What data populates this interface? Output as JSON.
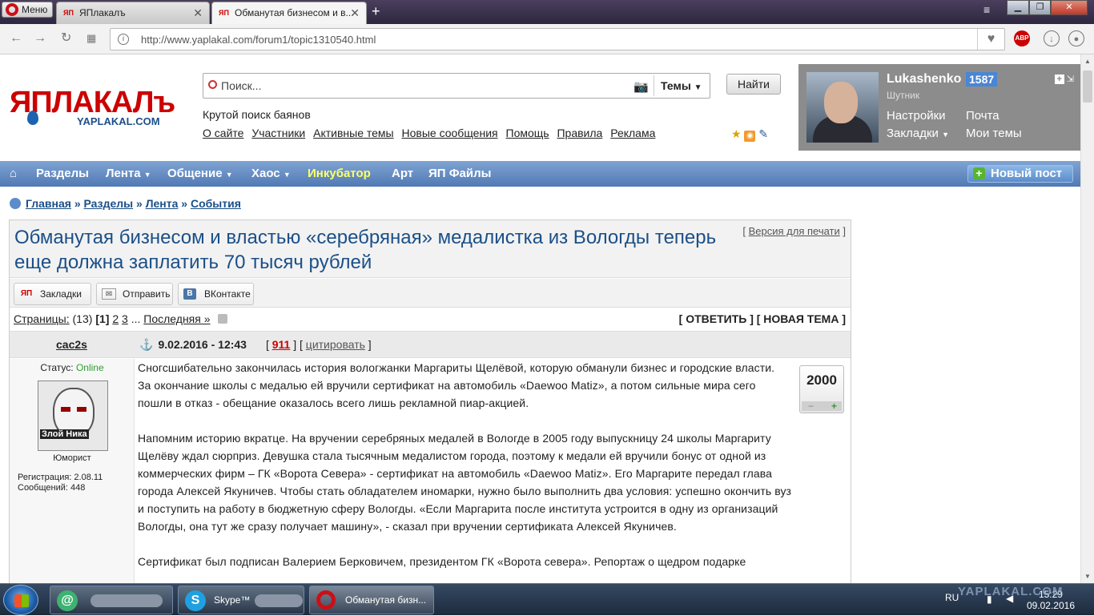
{
  "browser": {
    "menu_label": "Меню",
    "tabs": [
      {
        "favicon": "ЯП",
        "label": "ЯПлакалъ"
      },
      {
        "favicon": "ЯП",
        "label": "Обманутая бизнесом и в..."
      }
    ],
    "new_tab": "+",
    "url": "http://www.yaplakal.com/forum1/topic1310540.html"
  },
  "header": {
    "logo_main": "ЯПЛАКАЛъ",
    "logo_sub": "YAPLAKAL.COM",
    "search_placeholder": "Поиск...",
    "search_scope": "Темы",
    "search_button": "Найти",
    "tagline": "Крутой поиск баянов",
    "links": [
      "О сайте",
      "Участники",
      "Активные темы",
      "Новые сообщения",
      "Помощь",
      "Правила",
      "Реклама"
    ]
  },
  "user": {
    "name": "Lukashenko",
    "reputation": "1587",
    "rank": "Шутник",
    "links": {
      "settings": "Настройки",
      "mail": "Почта",
      "bookmarks": "Закладки",
      "my_topics": "Мои темы"
    }
  },
  "nav": {
    "home_icon": "home-icon",
    "items": [
      "Разделы",
      "Лента",
      "Общение",
      "Хаос",
      "Инкубатор",
      "Арт",
      "ЯП Файлы"
    ],
    "new_post": "Новый пост"
  },
  "breadcrumb": [
    "Главная",
    "Разделы",
    "Лента",
    "События"
  ],
  "topic": {
    "title": "Обманутая бизнесом и властью «серебряная» медалистка из Вологды теперь еще должна заплатить 70 тысяч рублей",
    "print_version": "Версия для печати",
    "share": {
      "bookmarks": "Закладки",
      "send": "Отправить",
      "vk": "ВКонтакте"
    },
    "pages": {
      "label": "Страницы:",
      "count": "(13)",
      "current": "1",
      "p2": "2",
      "p3": "3",
      "last": "Последняя »"
    },
    "reply": "[ ОТВЕТИТЬ ] [ НОВАЯ ТЕМА ]"
  },
  "post": {
    "author": "cac2s",
    "status_label": "Статус:",
    "status_value": "Online",
    "avatar_caption": "Злой Ника",
    "rank": "Юморист",
    "registration": "Регистрация: 2.08.11",
    "messages": "Сообщений: 448",
    "date": "9.02.2016 - 12:43",
    "number": "911",
    "quote": "цитировать",
    "rating": "2000",
    "paragraphs": [
      "Сногсшибательно закончилась история вологжанки Маргариты Щелёвой, которую обманули бизнес и городские власти. За окончание школы с медалью ей вручили сертификат на автомобиль «Daewoo Matiz», а потом сильные мира сего пошли в отказ - обещание оказалось всего лишь рекламной пиар-акцией.",
      "Напомним историю вкратце. На вручении серебряных медалей в Вологде в 2005 году выпускницу 24 школы Маргариту Щелёву ждал сюрприз. Девушка стала тысячным медалистом города, поэтому к медали ей вручили бонус от одной из коммерческих фирм – ГК «Ворота Севера» - сертификат на автомобиль «Daewoo Matiz». Его Маргарите передал глава города Алексей Якуничев. Чтобы стать обладателем иномарки, нужно было выполнить два условия: успешно окончить вуз и поступить на работу в бюджетную сферу Вологды. «Если Маргарита после института устроится в одну из организаций Вологды, она тут же сразу получает машину», - сказал при вручении сертификата Алексей Якуничев.",
      "Сертификат был подписан Валерием Берковичем, президентом ГК «Ворота севера». Репортаж о щедром подарке"
    ]
  },
  "taskbar": {
    "tasks": [
      "",
      "Skype™",
      "Обманутая бизн..."
    ],
    "lang": "RU",
    "time": "15:29",
    "date": "09.02.2016",
    "watermark": "YAPLAKAL.COM"
  }
}
